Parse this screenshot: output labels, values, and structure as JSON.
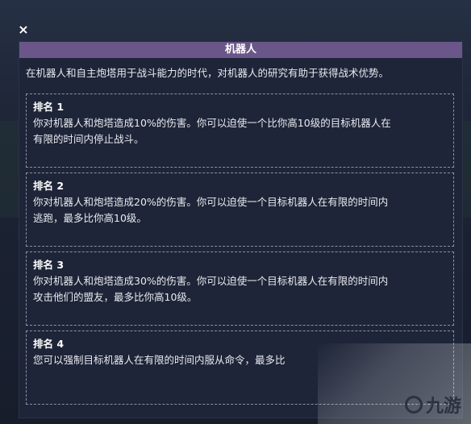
{
  "close_label": "×",
  "panel": {
    "title": "机器人",
    "intro": "在机器人和自主炮塔用于战斗能力的时代，对机器人的研究有助于获得战术优势。"
  },
  "ranks": [
    {
      "title": "排名 1",
      "lines": [
        "你对机器人和炮塔造成10%的伤害。你可以迫使一个比你高10级的目标机器人在",
        "有限的时间内停止战斗。"
      ]
    },
    {
      "title": "排名 2",
      "lines": [
        "你对机器人和炮塔造成20%的伤害。你可以迫使一个目标机器人在有限的时间内",
        "逃跑，最多比你高10级。"
      ]
    },
    {
      "title": "排名 3",
      "lines": [
        "你对机器人和炮塔造成30%的伤害。你可以迫使一个目标机器人在有限的时间内",
        "攻击他们的盟友，最多比你高10级。"
      ]
    },
    {
      "title": "排名 4",
      "lines": [
        "您可以强制目标机器人在有限的时间内服从命令，最多比"
      ]
    }
  ],
  "watermark": {
    "text": "九游"
  }
}
